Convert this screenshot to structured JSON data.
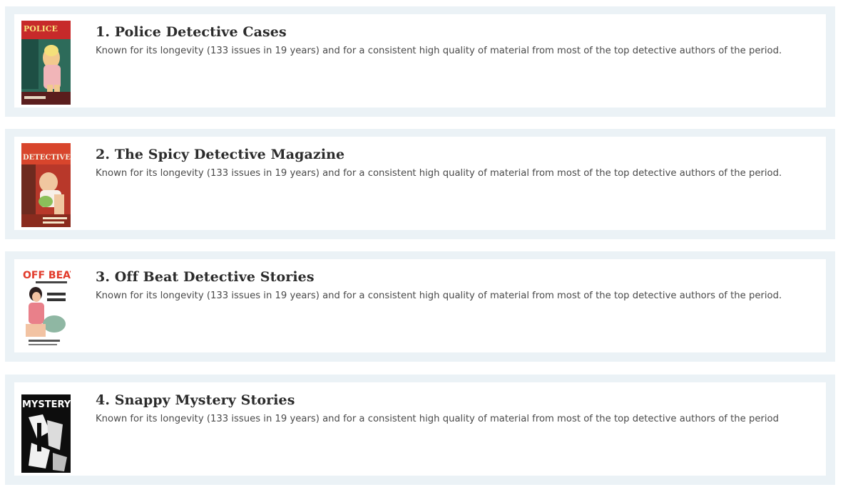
{
  "items": [
    {
      "title": "1. Police Detective Cases",
      "description": "Known for its longevity (133 issues in 19 years) and for a consistent high quality of material from most of the top detective authors of the period.",
      "cover": {
        "masthead": "POLICE",
        "icon": "pulp-cover-police-detective"
      }
    },
    {
      "title": "2. The Spicy Detective Magazine",
      "description": "Known for its longevity (133 issues in 19 years) and for a consistent high quality of material from most of the top detective authors of the period.",
      "cover": {
        "masthead": "DETECTIVE",
        "icon": "pulp-cover-spicy-detective"
      }
    },
    {
      "title": "3. Off Beat Detective Stories",
      "description": "Known for its longevity (133 issues in 19 years) and for a consistent high quality of material from most of the top detective authors of the period.",
      "cover": {
        "masthead": "OFF BEAT",
        "icon": "pulp-cover-off-beat"
      }
    },
    {
      "title": "4. Snappy Mystery Stories",
      "description": "Known for its longevity (133 issues in 19 years) and for a consistent high quality of material from most of the top detective authors of the period",
      "cover": {
        "masthead": "MYSTERY",
        "icon": "pulp-cover-snappy-mystery"
      }
    }
  ],
  "colors": {
    "card_border": "#ebf2f6",
    "title": "#2b2b2b",
    "description": "#4a4a4a"
  }
}
